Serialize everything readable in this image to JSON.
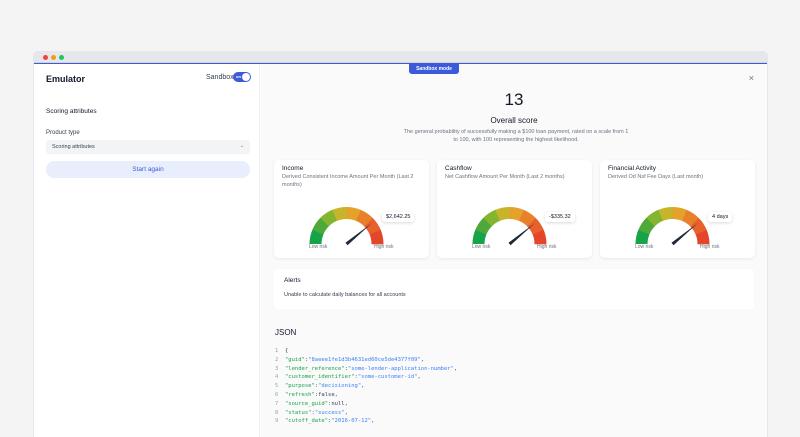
{
  "sidebar": {
    "title": "Emulator",
    "toggle_label": "Sandbox",
    "toggle_state": "on",
    "section_title": "Scoring attributes",
    "product_type_label": "Product type",
    "product_type_value": "Scoring attributes",
    "start_again_label": "Start again"
  },
  "main": {
    "badge": "Sandbox mode",
    "close_icon": "×",
    "score": "13",
    "score_title": "Overall score",
    "score_desc": "The general probability of successfully making a $100 loan payment, rated on a scale from 1 to 100, with 100 representing the highest likelihood."
  },
  "cards": [
    {
      "title": "Income",
      "subtitle": "Derived Consistent Income Amount Per Month (Last 2 months)",
      "value": "$2,642.25",
      "low": "Low risk",
      "high": "High risk",
      "needle": 0.78
    },
    {
      "title": "Cashflow",
      "subtitle": "Net Cashflow Amount Per Month (Last 2 months)",
      "value": "-$335.32",
      "low": "Low risk",
      "high": "High risk",
      "needle": 0.78
    },
    {
      "title": "Financial Activity",
      "subtitle": "Derived Od Nsf Fee Days (Last month)",
      "value": "4 days",
      "low": "Low risk",
      "high": "High risk",
      "needle": 0.78
    }
  ],
  "alerts": {
    "title": "Alerts",
    "message": "Unable to calculate daily balances for all accounts"
  },
  "json_view": {
    "title": "JSON",
    "lines": [
      {
        "n": "1",
        "text": "{"
      },
      {
        "n": "2",
        "text": "\"guid\":\"8aeee1fe1d3b4631ed60ce5de4377f09\","
      },
      {
        "n": "3",
        "text": "\"lender_reference\":\"some-lender-application-number\","
      },
      {
        "n": "4",
        "text": "\"customer_identifier\":\"some-customer-id\","
      },
      {
        "n": "5",
        "text": "\"purpose\":\"decisioning\","
      },
      {
        "n": "6",
        "text": "\"refresh\":false,"
      },
      {
        "n": "7",
        "text": "\"source_guid\":null,"
      },
      {
        "n": "8",
        "text": "\"status\":\"success\","
      },
      {
        "n": "9",
        "text": "\"cutoff_date\":\"2016-07-12\","
      }
    ]
  },
  "colors": {
    "accent": "#3b5bdb",
    "gauge_low": "#22c55e",
    "gauge_mid": "#eab308",
    "gauge_high": "#ef4444"
  }
}
